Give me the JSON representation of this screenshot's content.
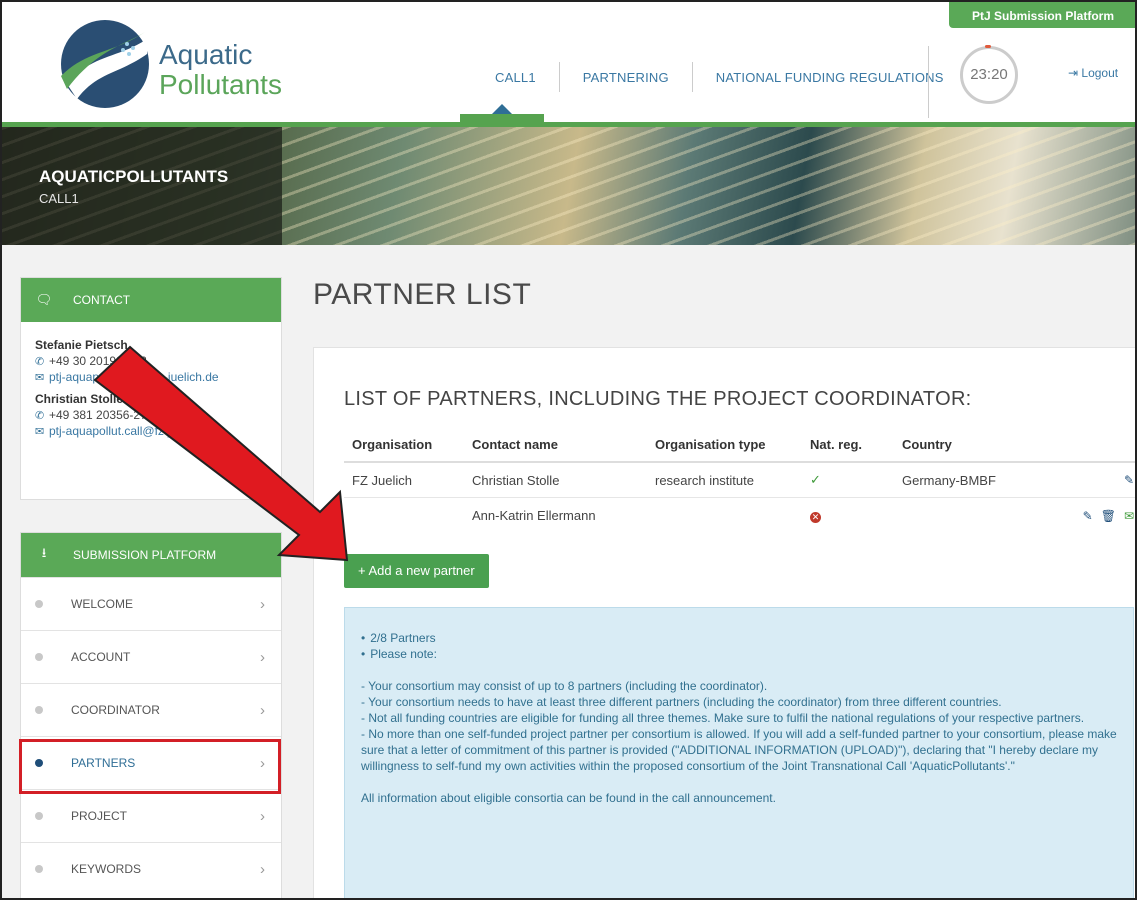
{
  "header": {
    "platform_tag": "PtJ Submission Platform",
    "logo_line1": "Aquatic",
    "logo_line2": "Pollutants",
    "nav": [
      "CALL1",
      "PARTNERING",
      "NATIONAL FUNDING REGULATIONS"
    ],
    "timer": "23:20",
    "logout": "Logout"
  },
  "banner": {
    "title": "AQUATICPOLLUTANTS",
    "subtitle": "CALL1"
  },
  "contact": {
    "heading": "CONTACT",
    "people": [
      {
        "name": "Stefanie Pietsch",
        "phone": "+49 30 20199-452",
        "email": "ptj-aquapollut.call@fz-juelich.de"
      },
      {
        "name": "Christian Stolle",
        "phone": "+49 381 20356-275",
        "email": "ptj-aquapollut.call@fz-juelich.de"
      }
    ]
  },
  "submission": {
    "heading": "SUBMISSION PLATFORM",
    "items": [
      "WELCOME",
      "ACCOUNT",
      "COORDINATOR",
      "PARTNERS",
      "PROJECT",
      "KEYWORDS"
    ],
    "active": "PARTNERS"
  },
  "main": {
    "page_title": "PARTNER LIST",
    "panel_title": "LIST OF PARTNERS, INCLUDING THE PROJECT COORDINATOR:",
    "columns": [
      "Organisation",
      "Contact name",
      "Organisation type",
      "Nat. reg.",
      "Country"
    ],
    "rows": [
      {
        "organisation": "FZ Juelich",
        "contact": "Christian Stolle",
        "type": "research institute",
        "natreg": "✓",
        "country": "Germany-BMBF"
      },
      {
        "organisation": "",
        "contact": "Ann-Katrin Ellermann",
        "type": "",
        "natreg": "✕",
        "country": ""
      }
    ],
    "add_button": "+ Add a new partner",
    "info": {
      "bullets": [
        "2/8 Partners",
        "Please note:"
      ],
      "lines": [
        "- Your consortium may consist of up to 8 partners (including the coordinator).",
        "- Your consortium needs to have at least three different partners (including the coordinator) from three different countries.",
        "- Not all funding countries are eligible for funding all three themes. Make sure to fulfil the national regulations of your respective partners.",
        "- No more than one self-funded project partner per consortium is allowed. If you will add a self-funded partner to your consortium, please make sure that a letter of commitment of this partner is provided (\"ADDITIONAL INFORMATION (UPLOAD)\"), declaring that \"I hereby declare my willingness to self-fund my own activities within the proposed consortium of the Joint Transnational Call 'AquaticPollutants'.\""
      ],
      "footer": "All information about eligible consortia can be found in the call announcement."
    }
  },
  "colors": {
    "brand_green": "#5aa957",
    "link_blue": "#3a78a3",
    "annotation_red": "#e0191f"
  }
}
